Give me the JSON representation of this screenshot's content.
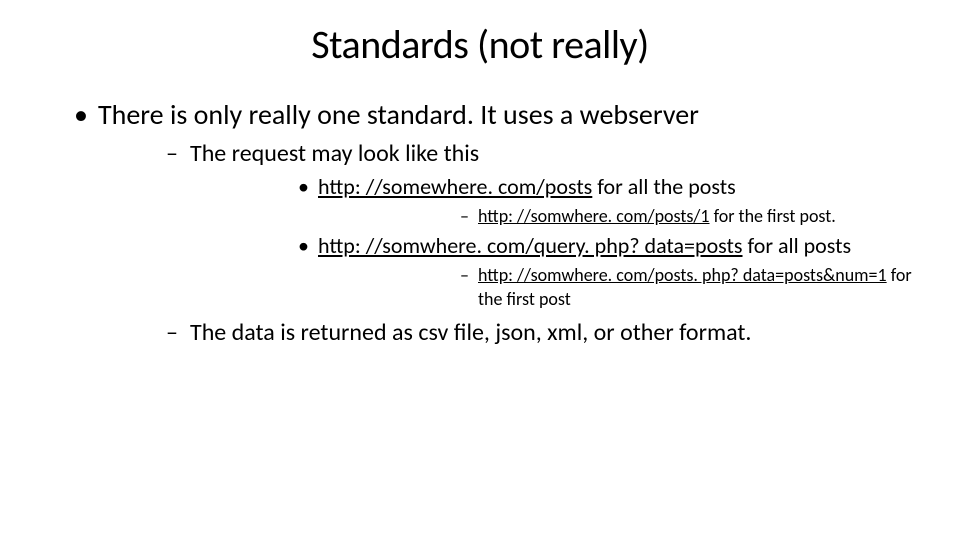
{
  "title": "Standards (not really)",
  "b1": {
    "text": "There is only really one standard.  It uses a webserver",
    "sub1": {
      "text": "The request may look like this",
      "item1": {
        "link": "http: //somewhere. com/posts",
        "after": " for all the posts",
        "sub": {
          "link": "http: //somwhere. com/posts/1",
          "after": "  for the first post."
        }
      },
      "item2": {
        "link": "http: //somwhere. com/query. php? data=posts",
        "after": " for all posts",
        "sub": {
          "link": "http: //somwhere. com/posts. php? data=posts&num=1",
          "after": " for the first post"
        }
      }
    },
    "sub2": {
      "text": "The data is returned as csv file, json, xml, or other format."
    }
  }
}
